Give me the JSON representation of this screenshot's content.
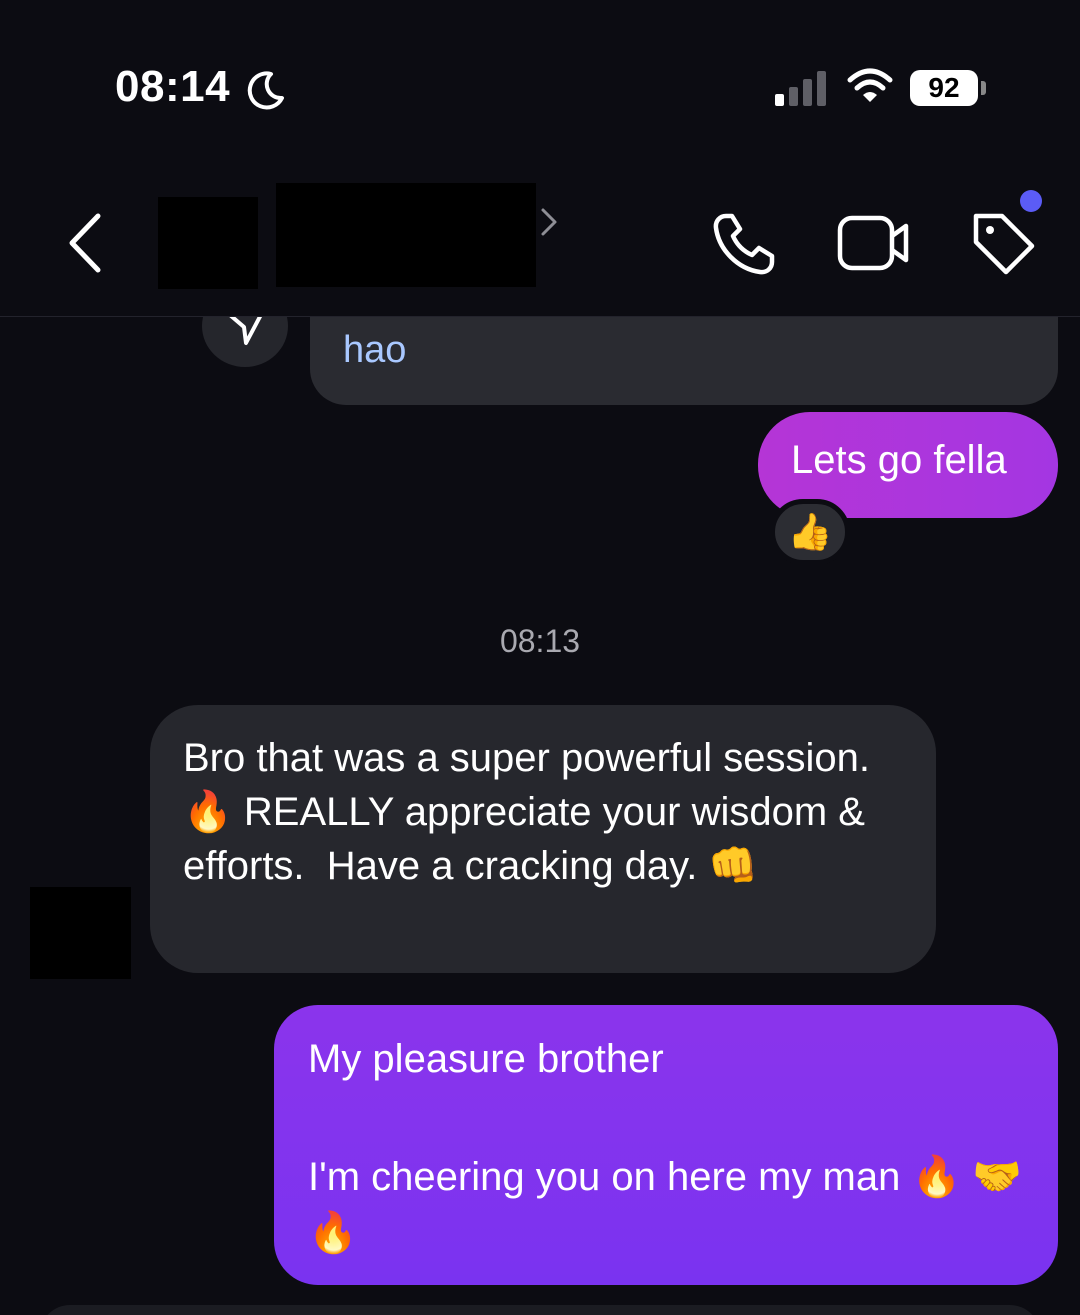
{
  "status": {
    "time": "08:14",
    "battery": "92"
  },
  "header": {
    "back_icon": "chevron-left-icon",
    "call_icon": "phone-icon",
    "video_icon": "video-icon",
    "tag_icon": "tag-icon",
    "colors": {
      "badge": "#5b5cf6"
    }
  },
  "messages": {
    "prev_link_tail": "hao",
    "mine_1": "Lets go fella",
    "mine_1_reaction": "👍",
    "timestamp": "08:13",
    "theirs": "Bro that was a super powerful session. 🔥 REALLY appreciate your wisdom & efforts.  Have a cracking day. 👊",
    "mine_2_line1": "My pleasure brother",
    "mine_2_line2": "I'm cheering you on here my man 🔥 🤝 🔥"
  },
  "colors": {
    "background": "#0c0c12",
    "incoming_bubble": "#26272d",
    "outgoing_bubble_1": "#b535d6",
    "outgoing_bubble_2": "#8b34ec",
    "link": "#a9c8ff"
  }
}
